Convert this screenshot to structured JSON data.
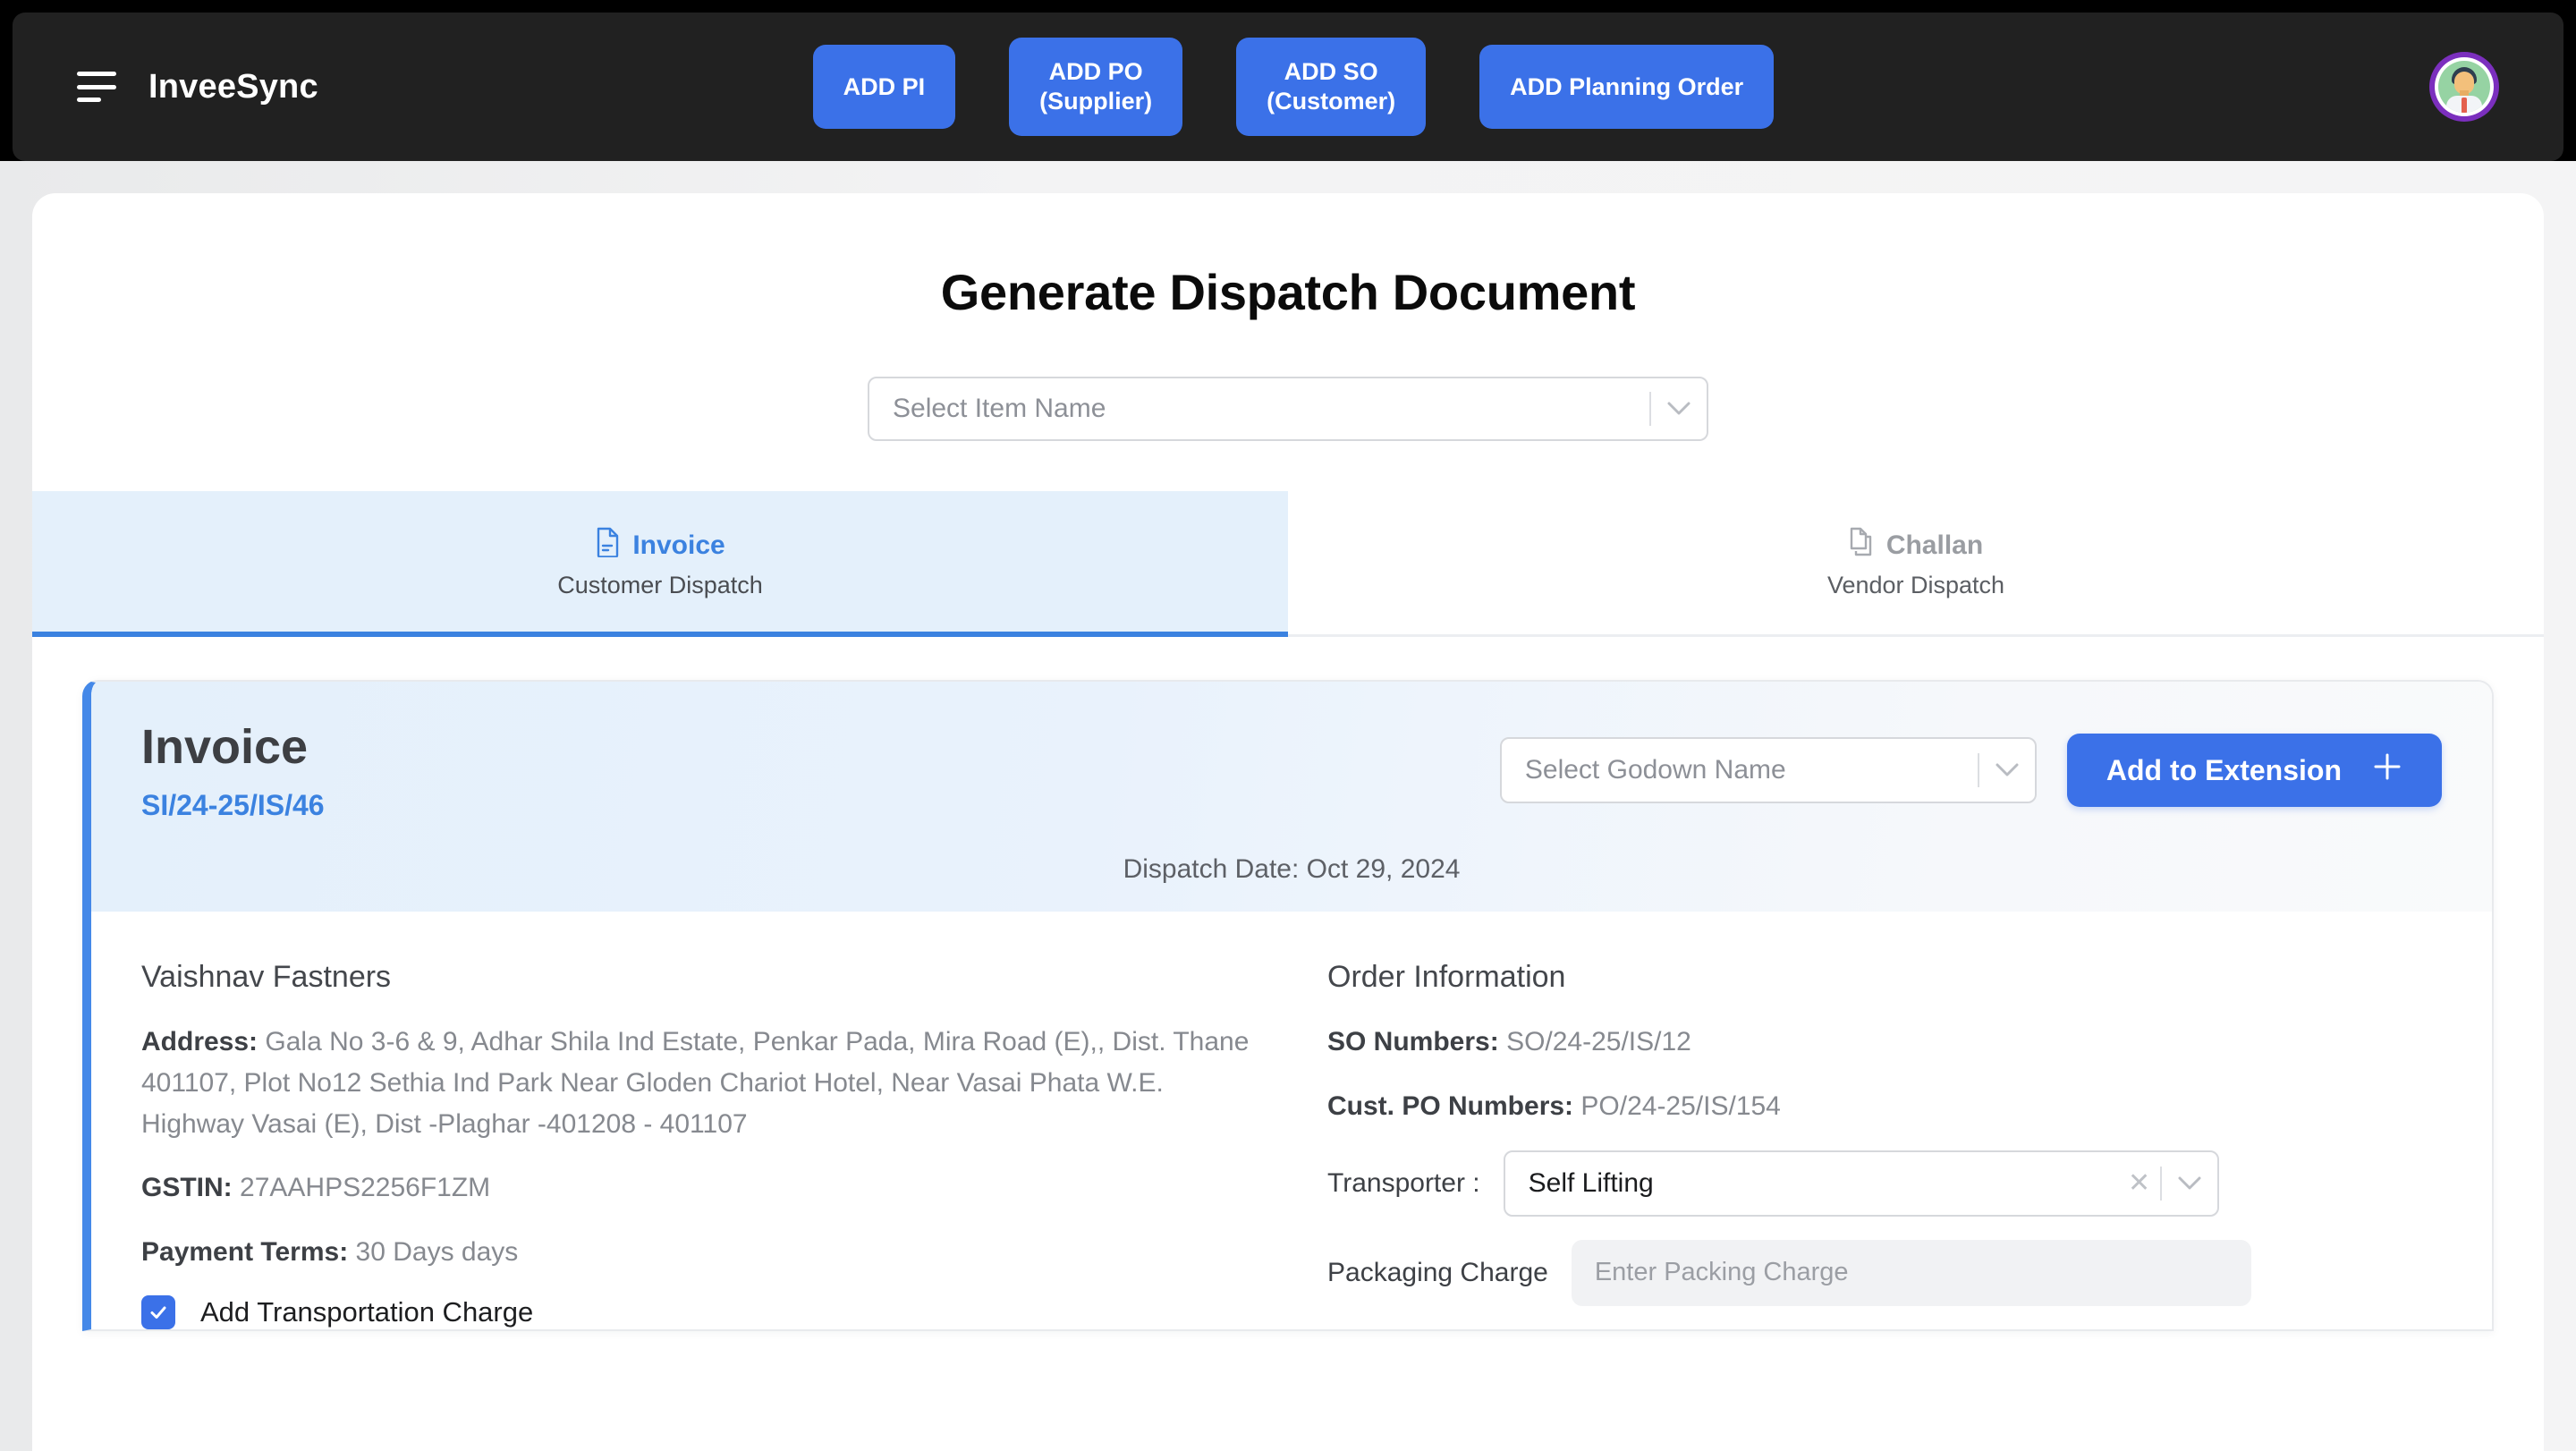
{
  "header": {
    "brand": "InveeSync",
    "menu_icon": "hamburger-icon",
    "buttons": [
      {
        "label": "ADD PI"
      },
      {
        "label": "ADD PO\n(Supplier)"
      },
      {
        "label": "ADD SO\n(Customer)"
      },
      {
        "label": "ADD Planning Order"
      }
    ],
    "avatar_alt": "user-avatar",
    "bg_color": "#212121",
    "accent_color": "#3b71e8"
  },
  "page": {
    "title": "Generate Dispatch Document",
    "item_select": {
      "placeholder": "Select Item Name",
      "value": ""
    }
  },
  "tabs": [
    {
      "label": "Invoice",
      "sublabel": "Customer Dispatch",
      "icon": "file-text-icon",
      "active": true,
      "active_color": "#3b82e0"
    },
    {
      "label": "Challan",
      "sublabel": "Vendor Dispatch",
      "icon": "copy-documents-icon",
      "active": false
    }
  ],
  "invoice_card": {
    "title": "Invoice",
    "number": "SI/24-25/IS/46",
    "accent_color": "#4488e8",
    "godown_select": {
      "placeholder": "Select Godown Name",
      "value": ""
    },
    "add_extension_button": {
      "label": "Add to Extension",
      "icon": "plus-icon"
    },
    "dispatch_date": "Dispatch Date: Oct 29, 2024",
    "customer": {
      "name": "Vaishnav Fastners",
      "address_label": "Address:",
      "address_value": "Gala No 3-6 & 9, Adhar Shila Ind Estate, Penkar Pada, Mira Road (E),, Dist. Thane 401107, Plot No12 Sethia Ind Park Near Gloden Chariot Hotel, Near Vasai Phata W.E. Highway Vasai (E), Dist -Plaghar -401208 - 401107",
      "gstin_label": "GSTIN:",
      "gstin_value": "27AAHPS2256F1ZM",
      "payment_terms_label": "Payment Terms:",
      "payment_terms_value": "30 Days days",
      "transportation_checkbox_label": "Add Transportation Charge",
      "transportation_checked": true
    },
    "order_information": {
      "title": "Order Information",
      "so_label": "SO Numbers:",
      "so_value": "SO/24-25/IS/12",
      "po_label": "Cust. PO Numbers:",
      "po_value": "PO/24-25/IS/154",
      "transporter_label": "Transporter :",
      "transporter_value": "Self Lifting",
      "packaging_label": "Packaging Charge",
      "packaging_placeholder": "Enter Packing Charge",
      "packaging_value": ""
    }
  }
}
